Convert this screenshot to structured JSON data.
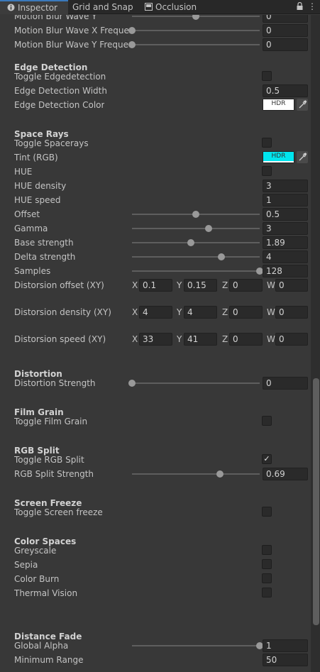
{
  "tabs": [
    {
      "label": "Inspector",
      "icon": "info-icon"
    },
    {
      "label": "Grid and Snap",
      "icon": ""
    },
    {
      "label": "Occlusion",
      "icon": "occlusion-icon"
    }
  ],
  "colors": {
    "accent": "#3a79bb",
    "tint": "#00e5ee",
    "edge_color": "#ffffff"
  },
  "motion_blur": {
    "wave_y": {
      "label": "Motion Blur Wave Y",
      "value": "0",
      "slider_fraction": 0.5
    },
    "freq_x": {
      "label": "Motion Blur Wave X Frequency",
      "value": "0",
      "slider_fraction": 0.0
    },
    "freq_y": {
      "label": "Motion Blur Wave Y Frequency",
      "value": "0",
      "slider_fraction": 0.0
    }
  },
  "edge_detection": {
    "header": "Edge Detection",
    "toggle_label": "Toggle Edgedetection",
    "toggle_checked": false,
    "width_label": "Edge Detection Width",
    "width_value": "0.5",
    "color_label": "Edge Detection Color",
    "color_hdr": "HDR"
  },
  "space_rays": {
    "header": "Space Rays",
    "toggle_label": "Toggle Spacerays",
    "toggle_checked": false,
    "tint_label": "Tint (RGB)",
    "tint_hdr": "HDR",
    "hue_label": "HUE",
    "hue_checked": false,
    "hue_density_label": "HUE density",
    "hue_density_value": "3",
    "hue_speed_label": "HUE speed",
    "hue_speed_value": "1",
    "offset": {
      "label": "Offset",
      "value": "0.5",
      "slider_fraction": 0.5
    },
    "gamma": {
      "label": "Gamma",
      "value": "3",
      "slider_fraction": 0.6
    },
    "base_strength": {
      "label": "Base strength",
      "value": "1.89",
      "slider_fraction": 0.46
    },
    "delta_strength": {
      "label": "Delta strength",
      "value": "4",
      "slider_fraction": 0.7
    },
    "samples": {
      "label": "Samples",
      "value": "128",
      "slider_fraction": 1.0
    },
    "distorsion_offset": {
      "label": "Distorsion offset (XY)",
      "x": "0.1",
      "y": "0.15",
      "z": "0",
      "w": "0"
    },
    "distorsion_density": {
      "label": "Distorsion density (XY)",
      "x": "4",
      "y": "4",
      "z": "0",
      "w": "0"
    },
    "distorsion_speed": {
      "label": "Distorsion speed (XY)",
      "x": "33",
      "y": "41",
      "z": "0",
      "w": "0"
    },
    "axis_labels": {
      "x": "X",
      "y": "Y",
      "z": "Z",
      "w": "W"
    }
  },
  "distortion": {
    "header": "Distortion",
    "strength": {
      "label": "Distortion Strength",
      "value": "0",
      "slider_fraction": 0.0
    }
  },
  "film_grain": {
    "header": "Film Grain",
    "toggle_label": "Toggle Film Grain",
    "toggle_checked": false
  },
  "rgb_split": {
    "header": "RGB Split",
    "toggle_label": "Toggle RGB Split",
    "toggle_checked": true,
    "check_glyph": "✓",
    "strength": {
      "label": "RGB Split Strength",
      "value": "0.69",
      "slider_fraction": 0.69
    }
  },
  "screen_freeze": {
    "header": "Screen Freeze",
    "toggle_label": "Toggle Screen freeze",
    "toggle_checked": false
  },
  "color_spaces": {
    "header": "Color Spaces",
    "items": [
      {
        "label": "Greyscale",
        "checked": false
      },
      {
        "label": "Sepia",
        "checked": false
      },
      {
        "label": "Color Burn",
        "checked": false
      },
      {
        "label": "Thermal Vision",
        "checked": false
      }
    ]
  },
  "distance_fade": {
    "header": "Distance Fade",
    "global_alpha": {
      "label": "Global Alpha",
      "value": "1",
      "slider_fraction": 1.0
    },
    "min_range_label": "Minimum Range",
    "min_range_value": "50"
  },
  "menu_glyph": "⋮"
}
